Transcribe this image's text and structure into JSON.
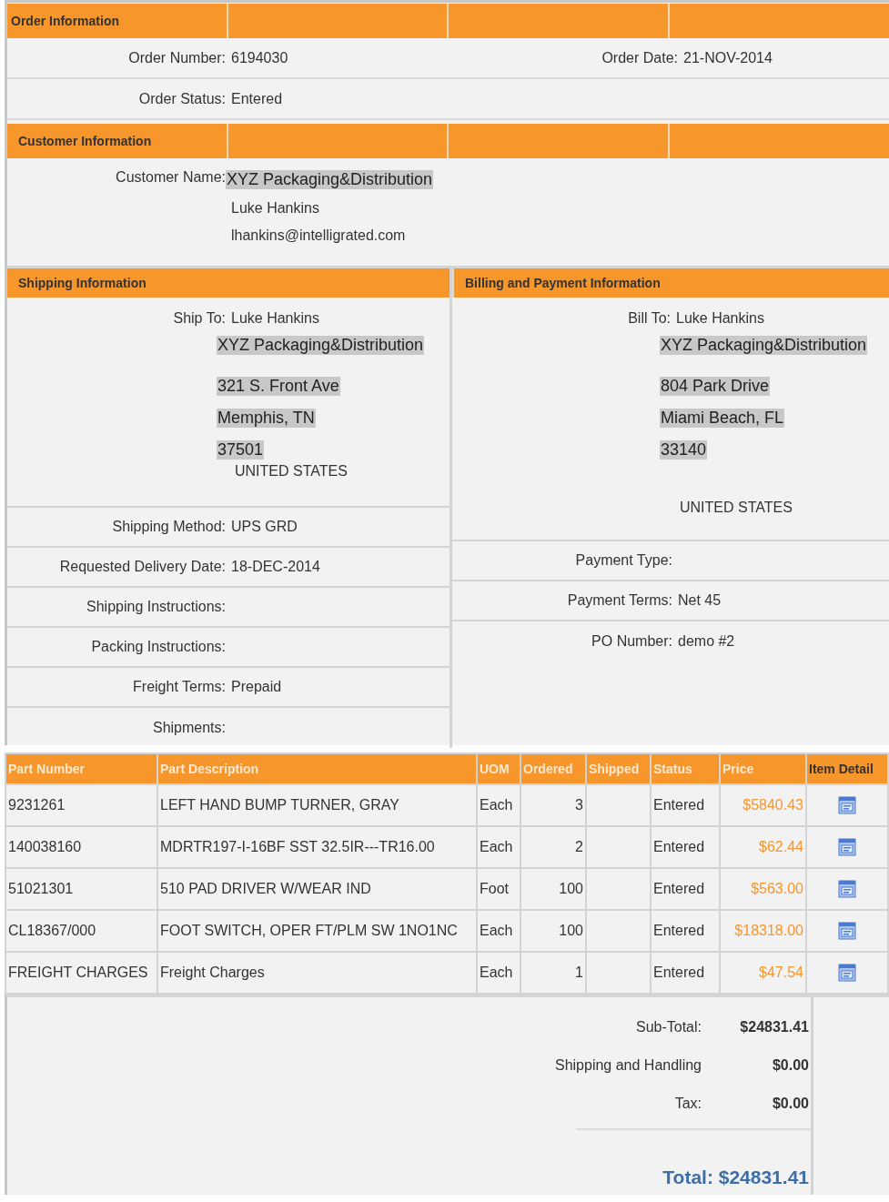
{
  "order_information": {
    "title": "Order Information",
    "rows": [
      [
        {
          "label": "Order Number:",
          "value": "6194030"
        },
        {
          "label": "Order Date:",
          "value": "21-NOV-2014"
        }
      ],
      [
        {
          "label": "Order Status:",
          "value": "Entered"
        }
      ]
    ]
  },
  "customer_information": {
    "title": "Customer Information",
    "label": "Customer Name:",
    "lines": [
      {
        "text": "XYZ Packaging&Distribution",
        "highlighted": true
      },
      {
        "text": "Luke Hankins",
        "highlighted": false
      },
      {
        "text": "lhankins@intelligrated.com",
        "highlighted": false
      }
    ]
  },
  "shipping_information": {
    "title": "Shipping Information",
    "recipient": {
      "label": "Ship To:",
      "value": "Luke Hankins"
    },
    "address": [
      {
        "text": "XYZ Packaging&Distribution",
        "highlighted": true
      },
      {
        "text": "321 S. Front Ave",
        "highlighted": true
      },
      {
        "text": "Memphis, TN",
        "highlighted": true
      },
      {
        "text": "37501",
        "highlighted": true
      }
    ],
    "country": "UNITED STATES",
    "fields": [
      {
        "label": "Shipping Method:",
        "value": "UPS GRD"
      },
      {
        "label": "Requested Delivery Date:",
        "value": "18-DEC-2014"
      },
      {
        "label": "Shipping Instructions:"
      },
      {
        "label": "Packing Instructions:"
      },
      {
        "label": "Freight Terms:",
        "value": "Prepaid"
      },
      {
        "label": "Shipments:"
      }
    ]
  },
  "billing_and_payment_information": {
    "title": "Billing and Payment Information",
    "recipient": {
      "label": "Bill To:",
      "value": "Luke Hankins"
    },
    "address": [
      {
        "text": "XYZ Packaging&Distribution",
        "highlighted": true
      },
      {
        "text": "804 Park Drive",
        "highlighted": true
      },
      {
        "text": "Miami Beach, FL",
        "highlighted": true
      },
      {
        "text": "33140",
        "highlighted": true
      }
    ],
    "country": "UNITED STATES",
    "fields": [
      {
        "label": "Payment Type:"
      },
      {
        "label": "Payment Terms:",
        "value": "Net 45"
      },
      {
        "label": "PO Number:",
        "value": "demo #2"
      }
    ]
  },
  "line_items": {
    "columns": [
      "Part Number",
      "Part Description",
      "UOM",
      "Ordered",
      "Shipped",
      "Status",
      "Price",
      "Item Detail"
    ],
    "rows": [
      {
        "part_number": "9231261",
        "description": "LEFT HAND BUMP TURNER, GRAY",
        "uom": "Each",
        "ordered": "3",
        "status": "Entered",
        "price": "$5840.43"
      },
      {
        "part_number": "140038160",
        "description": "MDRTR197-I-16BF SST 32.5IR---TR16.00",
        "uom": "Each",
        "ordered": "2",
        "status": "Entered",
        "price": "$62.44"
      },
      {
        "part_number": "51021301",
        "description": "510 PAD DRIVER W/WEAR IND",
        "uom": "Foot",
        "ordered": "100",
        "status": "Entered",
        "price": "$563.00"
      },
      {
        "part_number": "CL18367/000",
        "description": "FOOT SWITCH, OPER FT/PLM SW 1NO1NC",
        "uom": "Each",
        "ordered": "100",
        "status": "Entered",
        "price": "$18318.00"
      },
      {
        "part_number": "FREIGHT CHARGES",
        "description": "Freight Charges",
        "uom": "Each",
        "ordered": "1",
        "status": "Entered",
        "price": "$47.54"
      }
    ]
  },
  "totals": {
    "lines": [
      {
        "label": "Sub-Total:",
        "value": "$24831.41"
      },
      {
        "label": "Shipping and Handling",
        "value": "$0.00"
      },
      {
        "label": "Tax:",
        "value": "$0.00"
      }
    ],
    "total": "Total: $24831.41"
  }
}
